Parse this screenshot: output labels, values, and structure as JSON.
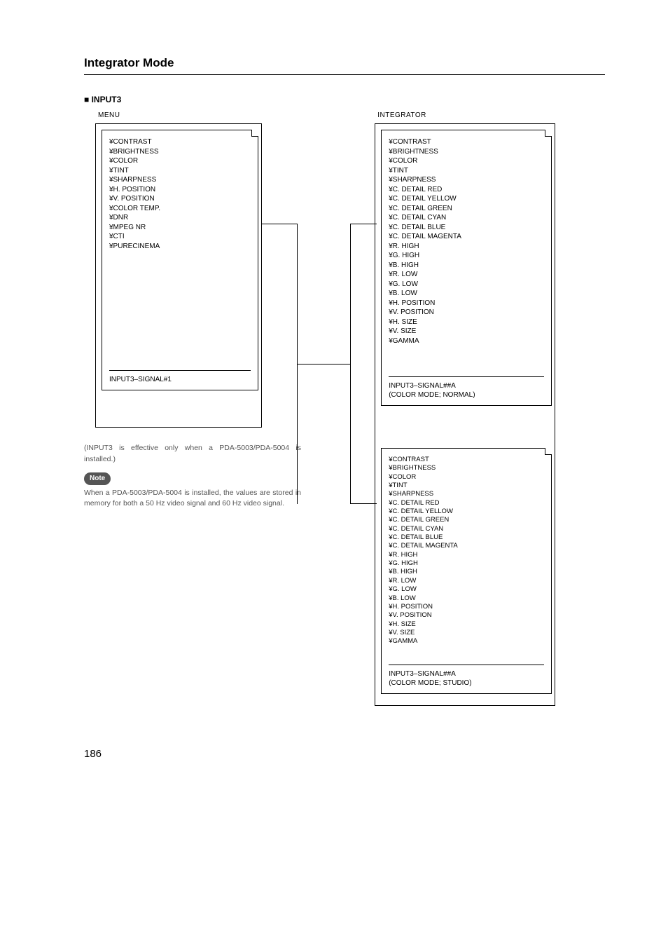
{
  "title": "Integrator Mode",
  "subhead": "■ INPUT3",
  "menuLabel": "MENU",
  "integratorLabel": "INTEGRATOR",
  "menuItems": {
    "i0": "¥CONTRAST",
    "i1": "¥BRIGHTNESS",
    "i2": "¥COLOR",
    "i3": "¥TINT",
    "i4": "¥SHARPNESS",
    "i5": "¥H. POSITION",
    "i6": "¥V. POSITION",
    "i7": "¥COLOR TEMP.",
    "i8": "¥DNR",
    "i9": "¥MPEG NR",
    "i10": "¥CTI",
    "i11": "¥PURECINEMA"
  },
  "menuFooter": "INPUT3–SIGNAL#1",
  "integratorItems": {
    "r0": "¥CONTRAST",
    "r1": "¥BRIGHTNESS",
    "r2": "¥COLOR",
    "r3": "¥TINT",
    "r4": "¥SHARPNESS",
    "r5": "¥C. DETAIL RED",
    "r6": "¥C. DETAIL YELLOW",
    "r7": "¥C. DETAIL GREEN",
    "r8": "¥C. DETAIL CYAN",
    "r9": "¥C. DETAIL BLUE",
    "r10": "¥C. DETAIL MAGENTA",
    "r11": "¥R. HIGH",
    "r12": "¥G. HIGH",
    "r13": "¥B. HIGH",
    "r14": "¥R. LOW",
    "r15": "¥G. LOW",
    "r16": "¥B. LOW",
    "r17": "¥H. POSITION",
    "r18": "¥V. POSITION",
    "r19": "¥H. SIZE",
    "r20": "¥V. SIZE",
    "r21": "¥GAMMA"
  },
  "integFooterA1": "INPUT3–SIGNAL##A",
  "integFooterA2": "(COLOR MODE; NORMAL)",
  "integFooterB1": "INPUT3–SIGNAL##A",
  "integFooterB2": "(COLOR MODE; STUDIO)",
  "note1": "(INPUT3 is effective only when a PDA-5003/PDA-5004 is installed.)",
  "noteBadge": "Note",
  "note2": "When a PDA-5003/PDA-5004 is installed, the values are stored in memory for both a 50 Hz video signal and 60 Hz video signal.",
  "pageNum": "186"
}
